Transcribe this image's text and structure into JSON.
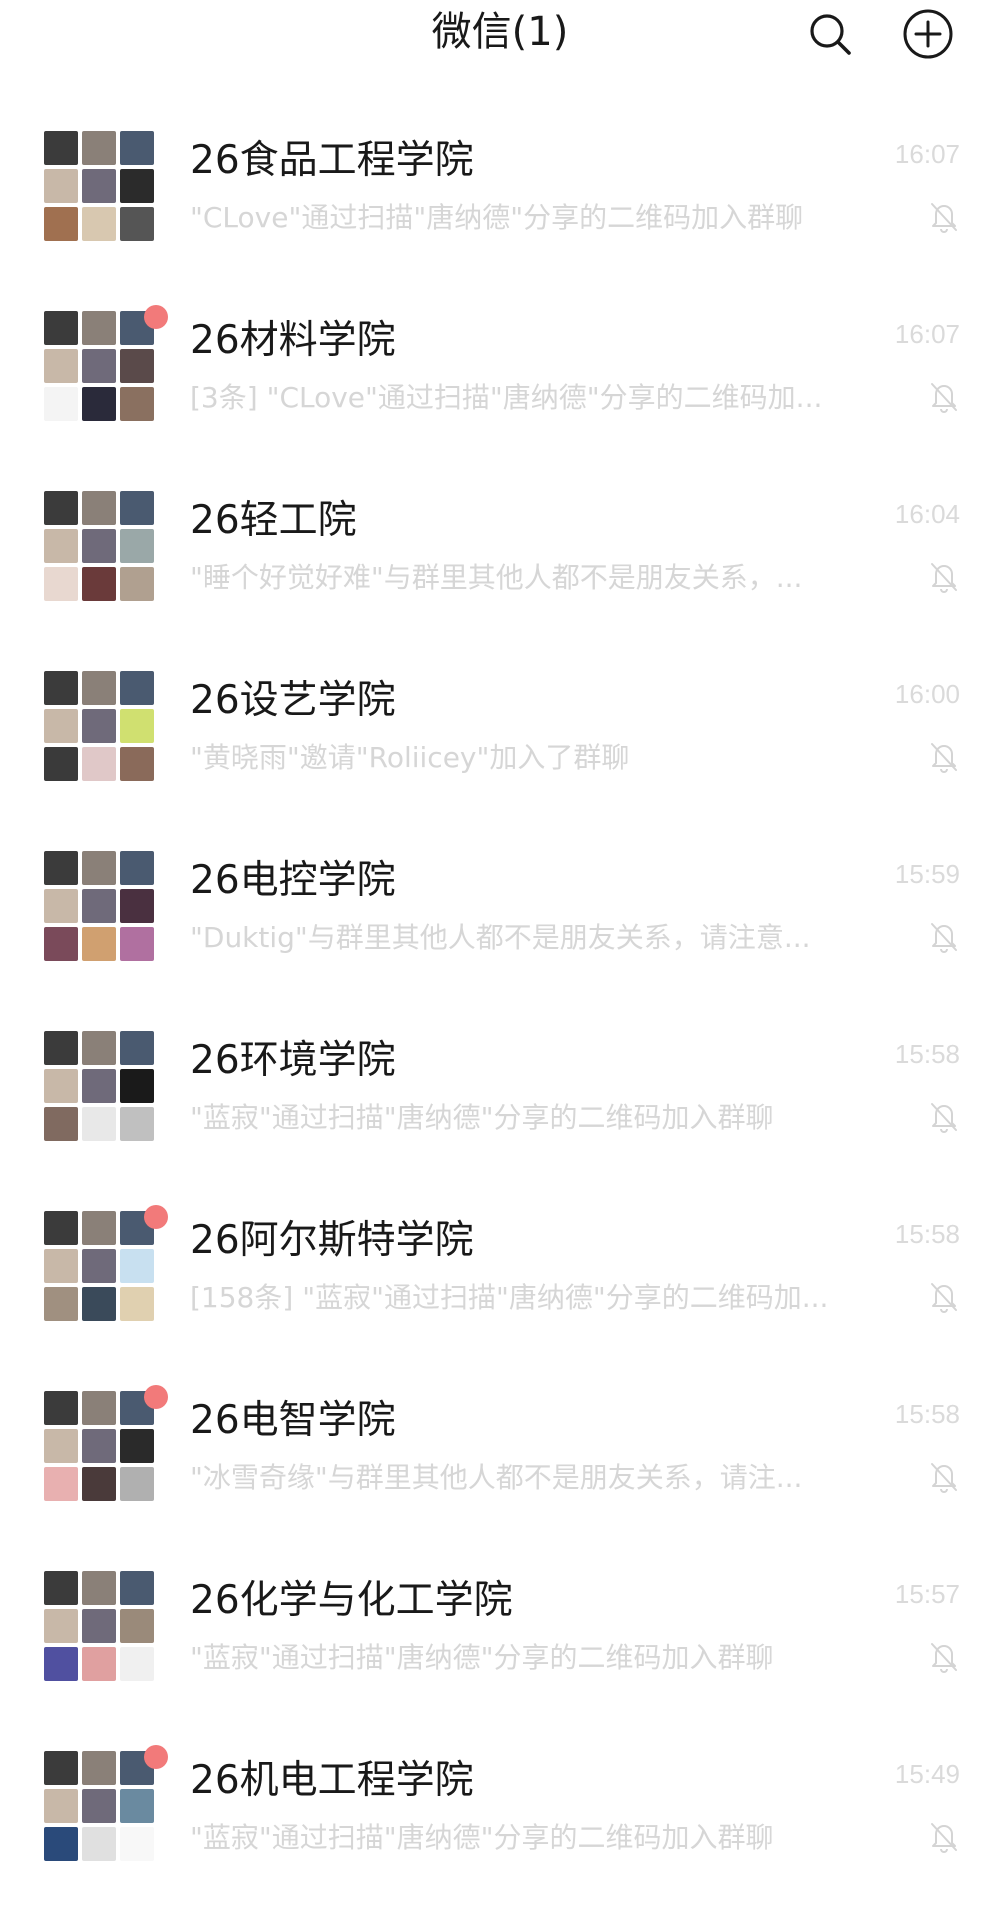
{
  "header": {
    "title": "微信(1)",
    "search_icon": "search-icon",
    "add_icon": "plus-circle-icon"
  },
  "colors": {
    "badge": "#f27a7a",
    "muted_text": "#d6d6d6",
    "primary_text": "#191919"
  },
  "chats": [
    {
      "name": "26食品工程学院",
      "time": "16:07",
      "preview": "\"CLove\"通过扫描\"唐纳德\"分享的二维码加入群聊",
      "unread_dot": false,
      "muted": true
    },
    {
      "name": "26材料学院",
      "time": "16:07",
      "preview": "[3条] \"CLove\"通过扫描\"唐纳德\"分享的二维码加...",
      "unread_dot": true,
      "muted": true
    },
    {
      "name": "26轻工院",
      "time": "16:04",
      "preview": "\"睡个好觉好难\"与群里其他人都不是朋友关系，...",
      "unread_dot": false,
      "muted": true
    },
    {
      "name": "26设艺学院",
      "time": "16:00",
      "preview": "\"黄晓雨\"邀请\"Roliicey\"加入了群聊",
      "unread_dot": false,
      "muted": true
    },
    {
      "name": "26电控学院",
      "time": "15:59",
      "preview": "\"Duktig\"与群里其他人都不是朋友关系，请注意...",
      "unread_dot": false,
      "muted": true
    },
    {
      "name": "26环境学院",
      "time": "15:58",
      "preview": "\"蓝寂\"通过扫描\"唐纳德\"分享的二维码加入群聊",
      "unread_dot": false,
      "muted": true
    },
    {
      "name": "26阿尔斯特学院",
      "time": "15:58",
      "preview": "[158条] \"蓝寂\"通过扫描\"唐纳德\"分享的二维码加...",
      "unread_dot": true,
      "muted": true
    },
    {
      "name": "26电智学院",
      "time": "15:58",
      "preview": "\"冰雪奇缘\"与群里其他人都不是朋友关系，请注...",
      "unread_dot": true,
      "muted": true
    },
    {
      "name": "26化学与化工学院",
      "time": "15:57",
      "preview": "\"蓝寂\"通过扫描\"唐纳德\"分享的二维码加入群聊",
      "unread_dot": false,
      "muted": true
    },
    {
      "name": "26机电工程学院",
      "time": "15:49",
      "preview": "\"蓝寂\"通过扫描\"唐纳德\"分享的二维码加入群聊",
      "unread_dot": true,
      "muted": true
    }
  ]
}
